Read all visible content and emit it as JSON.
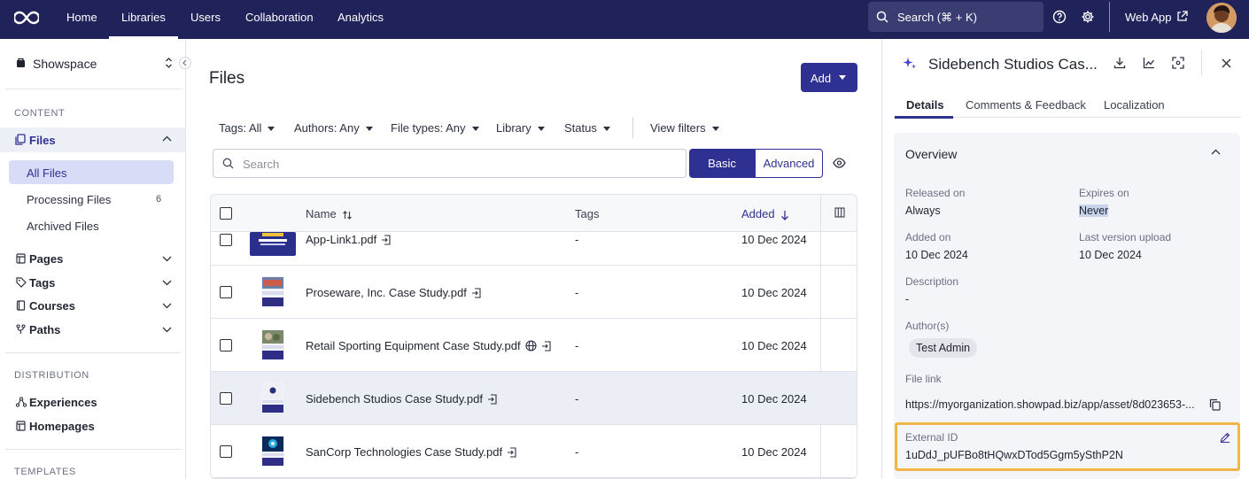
{
  "topbar": {
    "logo_icon": "infinity-logo-icon",
    "nav": [
      "Home",
      "Libraries",
      "Users",
      "Collaboration",
      "Analytics"
    ],
    "active_nav": "Libraries",
    "search_placeholder": "Search (⌘ + K)",
    "web_app_label": "Web App",
    "colors": {
      "bar": "#20235a",
      "search": "#3a3d71"
    }
  },
  "sidebar": {
    "workspace": "Showspace",
    "content_title": "CONTENT",
    "files_label": "Files",
    "files_subitems": {
      "all": "All Files",
      "processing": "Processing Files",
      "processing_count": "6",
      "archived": "Archived Files"
    },
    "pages": "Pages",
    "tags": "Tags",
    "courses": "Courses",
    "paths": "Paths",
    "distribution_title": "DISTRIBUTION",
    "experiences": "Experiences",
    "homepages": "Homepages",
    "templates_title": "TEMPLATES"
  },
  "main": {
    "title": "Files",
    "add_label": "Add",
    "filters": {
      "tags": "Tags: All",
      "authors": "Authors: Any",
      "file_types": "File types: Any",
      "library": "Library",
      "status": "Status",
      "view_filters": "View filters"
    },
    "search_placeholder": "Search",
    "mode_basic": "Basic",
    "mode_advanced": "Advanced",
    "table": {
      "col_name": "Name",
      "col_tags": "Tags",
      "col_added": "Added",
      "rows": [
        {
          "name": "App-Link1.pdf",
          "tags": "-",
          "added": "10 Dec 2024"
        },
        {
          "name": "Proseware, Inc. Case Study.pdf",
          "tags": "-",
          "added": "10 Dec 2024"
        },
        {
          "name": "Retail Sporting Equipment Case Study.pdf",
          "tags": "-",
          "added": "10 Dec 2024"
        },
        {
          "name": "Sidebench Studios Case Study.pdf",
          "tags": "-",
          "added": "10 Dec 2024"
        },
        {
          "name": "SanCorp Technologies Case Study.pdf",
          "tags": "-",
          "added": "10 Dec 2024"
        }
      ]
    },
    "accent_color": "#2e3192"
  },
  "panel": {
    "title": "Sidebench Studios Cas...",
    "tabs": [
      "Details",
      "Comments & Feedback",
      "Localization"
    ],
    "active_tab": "Details",
    "overview": {
      "title": "Overview",
      "released_label": "Released on",
      "released_value": "Always",
      "expires_label": "Expires on",
      "expires_value": "Never",
      "added_label": "Added on",
      "added_value": "10 Dec 2024",
      "last_version_label": "Last version upload",
      "last_version_value": "10 Dec 2024",
      "description_label": "Description",
      "description_value": "-",
      "authors_label": "Author(s)",
      "author_chip": "Test Admin",
      "file_link_label": "File link",
      "file_link_value": "https://myorganization.showpad.biz/app/asset/8d023653-...",
      "external_id_label": "External ID",
      "external_id_value": "1uDdJ_pUFBo8tHQwxDTod5Ggm5ySthP2N"
    },
    "highlight_color": "#f2b648"
  }
}
